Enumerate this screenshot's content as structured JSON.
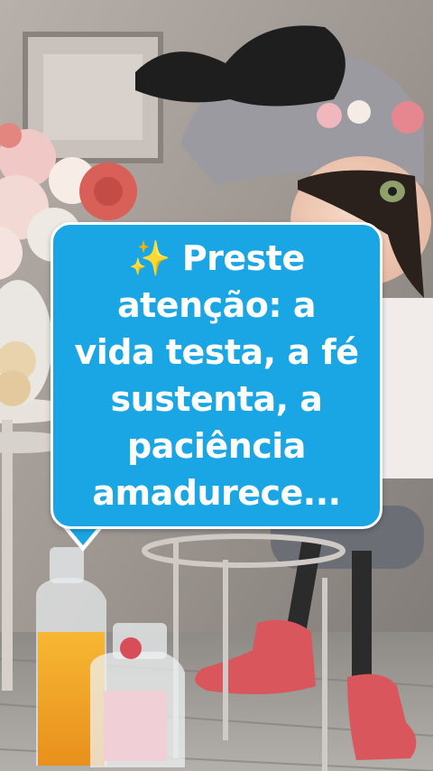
{
  "caption": {
    "emoji": "✨",
    "text": "Preste atenção: a vida testa, a fé sustenta, a paciência amadurece..."
  },
  "colors": {
    "bubble": "#1aa6e4",
    "bubble_border": "#ffffff",
    "text": "#ffffff"
  }
}
